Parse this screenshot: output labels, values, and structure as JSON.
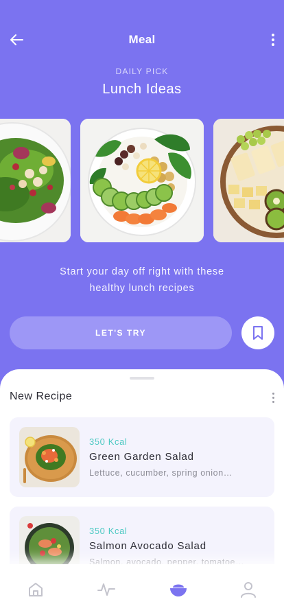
{
  "header": {
    "title": "Meal"
  },
  "hero": {
    "eyebrow": "DAILY PICK",
    "headline": "Lunch Ideas",
    "tagline_line1": "Start your day off right with these",
    "tagline_line2": "healthy lunch recipes",
    "cta_label": "LET'S TRY"
  },
  "section": {
    "title": "New Recipe"
  },
  "recipes": [
    {
      "kcal": "350 Kcal",
      "name": "Green Garden Salad",
      "desc": "Lettuce, cucumber, spring onion…"
    },
    {
      "kcal": "350 Kcal",
      "name": "Salmon Avocado Salad",
      "desc": "Salmon, avocado, pepper, tomatoes…"
    }
  ],
  "tabs": [
    {
      "icon": "home-icon"
    },
    {
      "icon": "activity-icon"
    },
    {
      "icon": "bowl-icon",
      "active": true
    },
    {
      "icon": "profile-icon"
    }
  ],
  "colors": {
    "brand": "#7b73f0",
    "button": "#9d97f6",
    "kcal": "#4ec9c3",
    "card_bg": "#f4f3fd"
  }
}
